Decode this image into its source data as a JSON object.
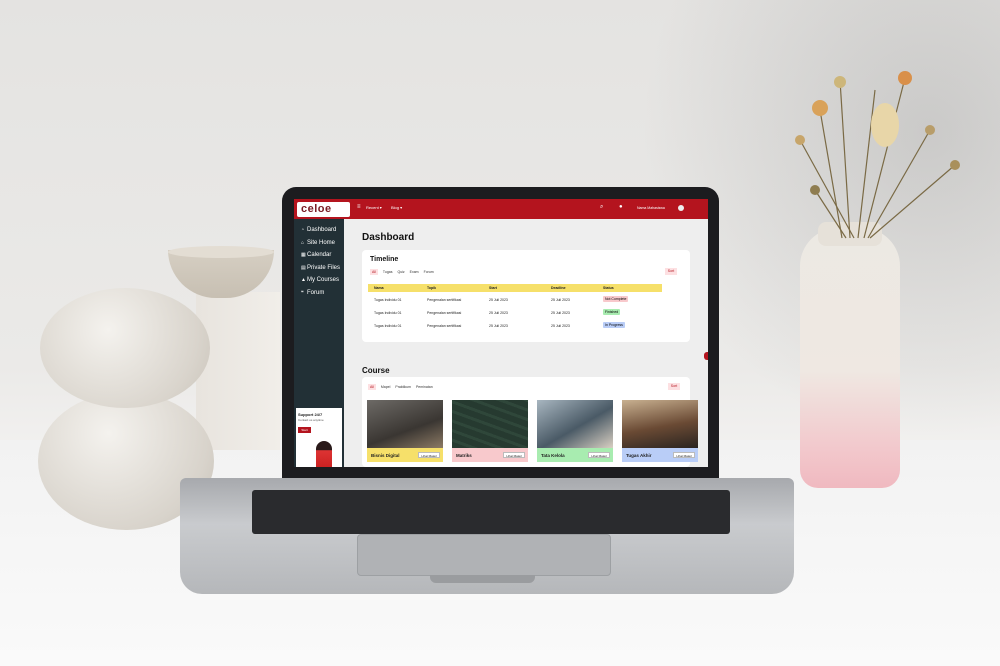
{
  "topbar": {
    "logo": "celoe",
    "nav": [
      "Recent ▾",
      "Blog ▾"
    ],
    "username": "Nama Mahasiswa",
    "icons": [
      "search-icon",
      "bell-icon"
    ]
  },
  "sidebar": {
    "items": [
      {
        "label": "Dashboard",
        "icon": "dashboard-icon"
      },
      {
        "label": "Site Home",
        "icon": "home-icon"
      },
      {
        "label": "Calendar",
        "icon": "calendar-icon"
      },
      {
        "label": "Private Files",
        "icon": "file-icon"
      },
      {
        "label": "My Courses",
        "icon": "graduation-cap-icon"
      },
      {
        "label": "Forum",
        "icon": "forum-icon"
      }
    ],
    "support": {
      "title": "Support 24/7",
      "subtitle": "Contact us anytime",
      "button": "Start"
    }
  },
  "main": {
    "title": "Dashboard",
    "timeline": {
      "title": "Timeline",
      "tabs": [
        "All",
        "Tugas",
        "Quiz",
        "Exam",
        "Forum"
      ],
      "sort_label": "Sort",
      "columns": [
        "Nama",
        "Topik",
        "Start",
        "Deadline",
        "Status"
      ],
      "rows": [
        {
          "nama": "Tugas Individu 01",
          "topik": "Pengenalan sertifikasi",
          "start": "25 Juli 2023",
          "deadline": "25 Juli 2023",
          "status": "Not Complete",
          "status_color": "#f8c9cc"
        },
        {
          "nama": "Tugas Individu 01",
          "topik": "Pengenalan sertifikasi",
          "start": "25 Juli 2023",
          "deadline": "25 Juli 2023",
          "status": "Finished",
          "status_color": "#a8ecb0"
        },
        {
          "nama": "Tugas Individu 01",
          "topik": "Pengenalan sertifikasi",
          "start": "25 Juli 2023",
          "deadline": "25 Juli 2023",
          "status": "In Progress",
          "status_color": "#b9cdf7"
        }
      ]
    },
    "course": {
      "title": "Course",
      "tabs": [
        "All",
        "Mapel",
        "Praktikum",
        "Peminatan"
      ],
      "sort_label": "Sort",
      "cards": [
        {
          "name": "Bisnis Digital",
          "button": "Lihat Materi",
          "color": "#f6e06a"
        },
        {
          "name": "Matriks",
          "button": "Lihat Materi",
          "color": "#f8c9cc"
        },
        {
          "name": "Tata Kelola",
          "button": "Lihat Materi",
          "color": "#a8ecb0"
        },
        {
          "name": "Tugas Akhir",
          "button": "Lihat Materi",
          "color": "#b9cdf7"
        }
      ]
    }
  },
  "colors": {
    "brand": "#b4141e",
    "sidebar": "#223036"
  }
}
